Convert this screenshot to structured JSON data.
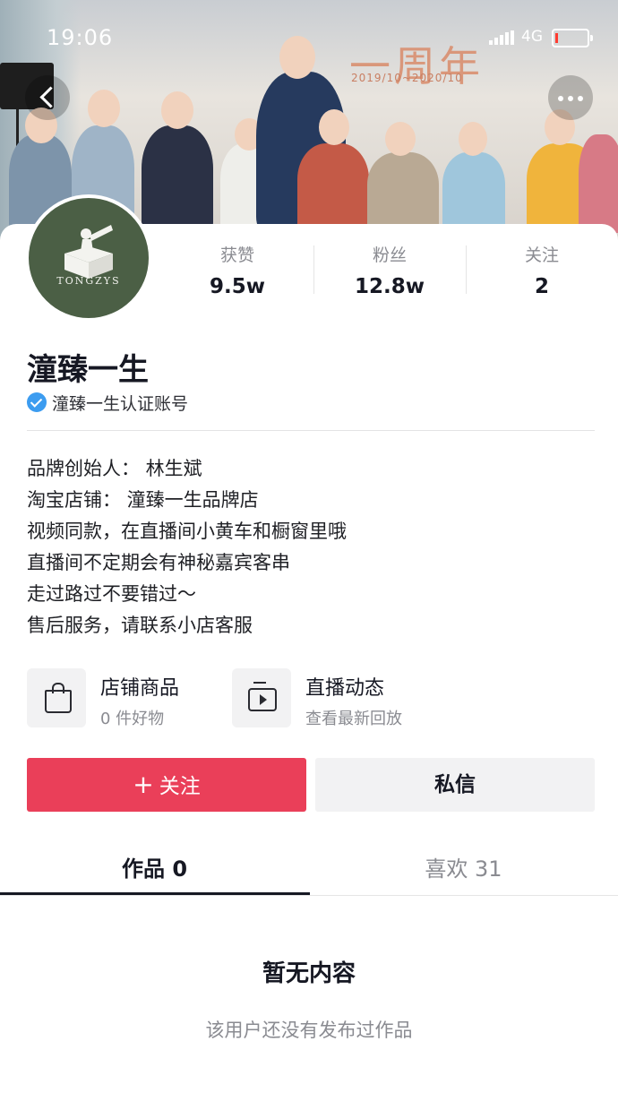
{
  "status_bar": {
    "time": "19:06",
    "network": "4G"
  },
  "cover": {
    "banner_text": "一周年",
    "banner_date": "2019/10~2020/10"
  },
  "profile": {
    "avatar_text": "TONGZYS",
    "name": "潼臻一生",
    "verified_text": "潼臻一生认证账号"
  },
  "stats": [
    {
      "label": "获赞",
      "value": "9.5w"
    },
    {
      "label": "粉丝",
      "value": "12.8w"
    },
    {
      "label": "关注",
      "value": "2"
    }
  ],
  "bio": [
    "品牌创始人：  林生斌",
    "淘宝店铺：  潼臻一生品牌店",
    "视频同款，在直播间小黄车和橱窗里哦",
    "直播间不定期会有神秘嘉宾客串",
    "走过路过不要错过～",
    "售后服务，请联系小店客服"
  ],
  "features": [
    {
      "title": "店铺商品",
      "subtitle": "0 件好物",
      "icon": "shopping-bag-icon"
    },
    {
      "title": "直播动态",
      "subtitle": "查看最新回放",
      "icon": "tv-play-icon"
    }
  ],
  "actions": {
    "follow_plus": "+",
    "follow_label": "关注",
    "message_label": "私信"
  },
  "tabs": [
    {
      "label": "作品 0",
      "active": true
    },
    {
      "label": "喜欢 31",
      "active": false
    }
  ],
  "empty_state": {
    "title": "暂无内容",
    "subtitle": "该用户还没有发布过作品"
  },
  "colors": {
    "accent": "#ea3f59",
    "verified": "#3c9cf0",
    "avatar_bg": "#4b5f45"
  }
}
